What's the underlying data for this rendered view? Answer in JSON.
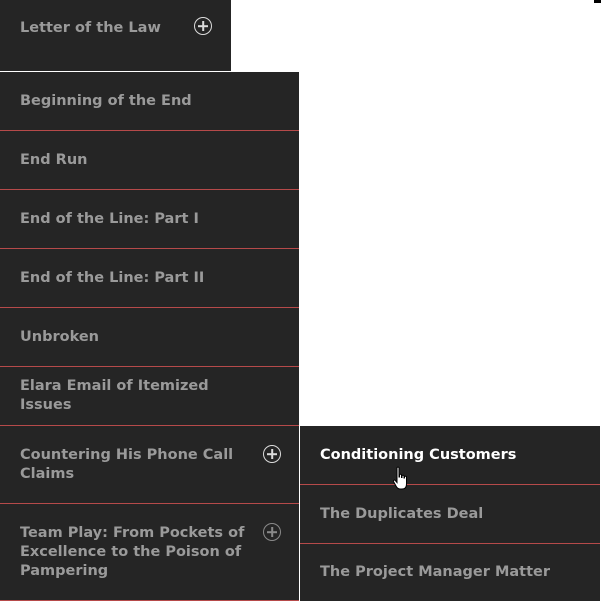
{
  "top_item": {
    "label": "Letter of the Law"
  },
  "main_menu": {
    "items": [
      {
        "label": "Beginning of the End"
      },
      {
        "label": "End Run"
      },
      {
        "label": "End of the Line: Part I"
      },
      {
        "label": "End of the Line: Part II"
      },
      {
        "label": "Unbroken"
      },
      {
        "label": "Elara Email of Itemized Issues"
      },
      {
        "label": "Countering His Phone Call Claims"
      },
      {
        "label": "Team Play: From Pockets of Excellence to the Poison of Pampering"
      }
    ]
  },
  "submenu": {
    "items": [
      {
        "label": "Conditioning Customers"
      },
      {
        "label": "The Duplicates Deal"
      },
      {
        "label": "The Project Manager Matter"
      }
    ]
  },
  "colors": {
    "panel": "#252525",
    "separator": "#b64a4a",
    "text": "#9a9a9a",
    "active_text": "#ffffff"
  }
}
